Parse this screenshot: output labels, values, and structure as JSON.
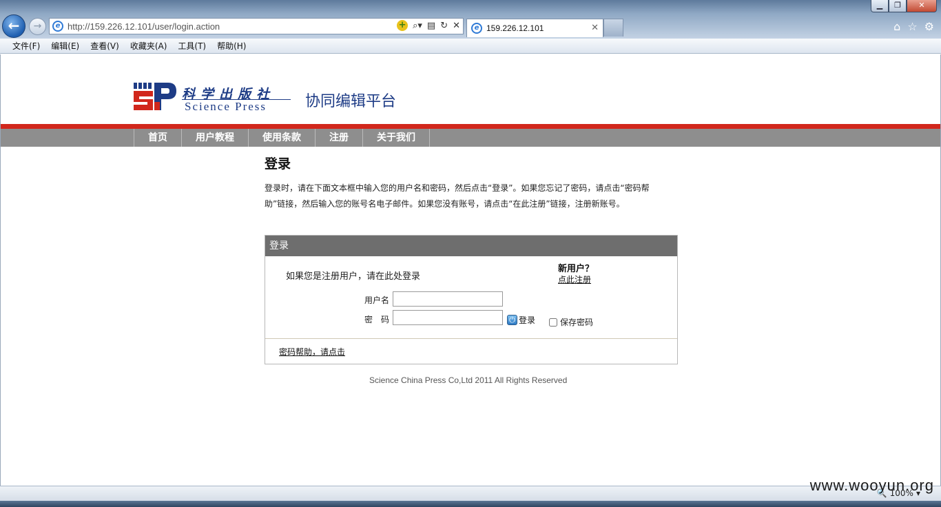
{
  "browser": {
    "url": "http://159.226.12.101/user/login.action",
    "tab_title": "159.226.12.101",
    "menu": [
      "文件(F)",
      "编辑(E)",
      "查看(V)",
      "收藏夹(A)",
      "工具(T)",
      "帮助(H)"
    ],
    "zoom": "100%"
  },
  "site": {
    "logo_cn": "科学出版社",
    "logo_en": "Science Press",
    "platform_title": "协同编辑平台",
    "nav": [
      "首页",
      "用户教程",
      "使用条款",
      "注册",
      "关于我们"
    ]
  },
  "login_page": {
    "title": "登录",
    "intro": "登录时，请在下面文本框中输入您的用户名和密码，然后点击“登录”。如果您忘记了密码，请点击“密码帮助”链接，然后输入您的账号名电子邮件。如果您没有账号，请点击“在此注册”链接，注册新账号。",
    "box_header": "登录",
    "prompt": "如果您是注册用户，请在此处登录",
    "new_user_title": "新用户？",
    "register_link": "点此注册",
    "username_label": "用户名",
    "password_label": "密　码",
    "username_value": "",
    "password_value": "",
    "login_button": "登录",
    "remember_label": "保存密码",
    "password_help": "密码帮助，请点击"
  },
  "footer": "Science China Press Co,Ltd 2011 All Rights Reserved",
  "watermark": "www.wooyun.org",
  "colors": {
    "brand_blue": "#1e3c86",
    "red_bar": "#d1271c",
    "nav_gray": "#8e8e8e",
    "box_header": "#6e6e6e"
  }
}
